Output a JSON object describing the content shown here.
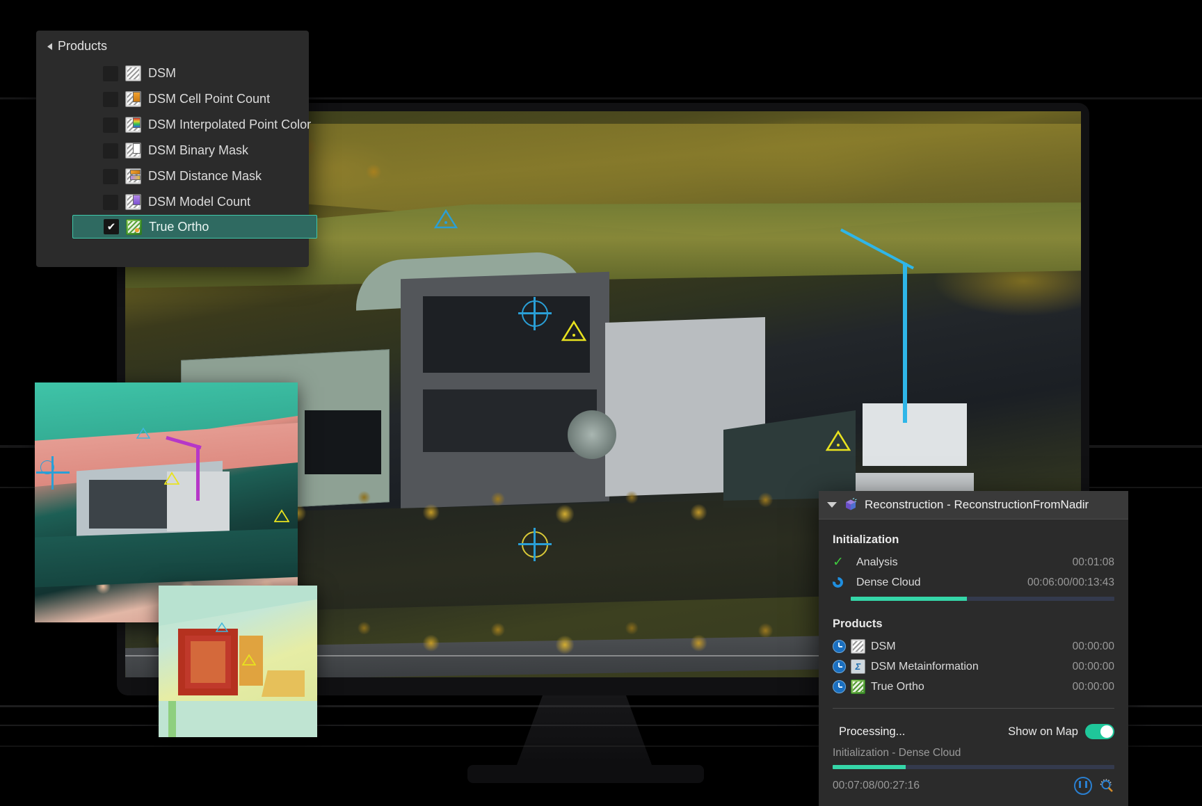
{
  "products_panel": {
    "root_label": "Products",
    "items": [
      {
        "label": "DSM",
        "checked": false,
        "icon": "dsm-icon"
      },
      {
        "label": "DSM Cell Point Count",
        "checked": false,
        "icon": "dsm-cell-point-count-icon"
      },
      {
        "label": "DSM Interpolated Point Color",
        "checked": false,
        "icon": "dsm-interpolated-point-color-icon"
      },
      {
        "label": "DSM Binary Mask",
        "checked": false,
        "icon": "dsm-binary-mask-icon"
      },
      {
        "label": "DSM Distance Mask",
        "checked": false,
        "icon": "dsm-distance-mask-icon"
      },
      {
        "label": "DSM Model Count",
        "checked": false,
        "icon": "dsm-model-count-icon"
      },
      {
        "label": "True Ortho",
        "checked": true,
        "icon": "true-ortho-icon"
      }
    ],
    "selected_label": "True Ortho",
    "check_glyph": "✔",
    "selection_color": "#2f6a61",
    "selection_border_color": "#3fc8aa"
  },
  "reconstruction_panel": {
    "title": "Reconstruction - ReconstructionFromNadir",
    "header_icon": "cube-icon",
    "collapse_icon": "chevron-down-icon",
    "sections": [
      {
        "title": "Initialization",
        "tasks": [
          {
            "status": "done",
            "status_icon": "check-icon",
            "name": "Analysis",
            "time": "00:01:08",
            "progress": null
          },
          {
            "status": "running",
            "status_icon": "spinner-icon",
            "name": "Dense Cloud",
            "time": "00:06:00/00:13:43",
            "progress": 44
          }
        ]
      },
      {
        "title": "Products",
        "tasks": [
          {
            "status": "pending",
            "status_icon": "clock-icon",
            "item_icon": "dsm-icon",
            "name": "DSM",
            "time": "00:00:00",
            "progress": null
          },
          {
            "status": "pending",
            "status_icon": "clock-icon",
            "item_icon": "dsm-metainformation-icon",
            "name": "DSM Metainformation",
            "time": "00:00:00",
            "progress": null
          },
          {
            "status": "pending",
            "status_icon": "clock-icon",
            "item_icon": "true-ortho-icon",
            "name": "True Ortho",
            "time": "00:00:00",
            "progress": null
          }
        ]
      }
    ],
    "footer": {
      "status_icon": "spinner-icon",
      "status_text": "Processing...",
      "show_on_map_label": "Show on Map",
      "show_on_map_enabled": true,
      "current_step": "Initialization - Dense Cloud",
      "overall_progress": 26,
      "overall_time": "00:07:08/00:27:16",
      "pause_button_icon": "pause-icon",
      "inspect_button_icon": "inspect-magnifier-icon"
    },
    "accent_color": "#35d6a8",
    "toggle_color": "#1fc79a"
  },
  "viewport": {
    "name": "true-ortho-aerial-view",
    "description": "True orthophoto of riverside industrial facility"
  },
  "insets": [
    {
      "name": "false-color-ortho-inset"
    },
    {
      "name": "dsm-classification-inset"
    }
  ]
}
